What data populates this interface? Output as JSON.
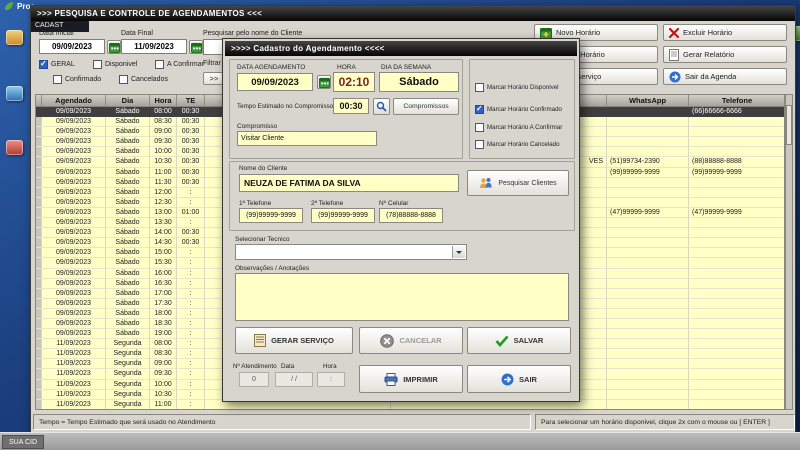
{
  "desktop": {
    "bg_window_title": "Proc",
    "window_fragment": "CADAST",
    "taskbar_button": "SUA CID"
  },
  "window": {
    "title": ">>>   PESQUISA E CONTROLE DE AGENDAMENTOS   <<<",
    "filters": {
      "data_inicial_label": "Data Inicial",
      "data_inicial_value": "09/09/2023",
      "data_final_label": "Data Final",
      "data_final_value": "11/09/2023",
      "search_label": "Pesquisar pelo nome do Cliente",
      "search_value": "",
      "geral": "GERAL",
      "disponivel": "Disponivel",
      "a_confirmar": "A Confirmar",
      "confirmado": "Confirmado",
      "cancelados": "Cancelados",
      "filtrar": "Filtrar",
      "expand": ">>"
    },
    "actions": {
      "novo": "Novo Horário",
      "excluir": "Excluir Horário",
      "alterar": "Alterar Horário",
      "relatorio": "Gerar Relatório",
      "servico": "Gerar Serviço",
      "sair": "Sair da Agenda"
    },
    "table": {
      "headers": [
        "",
        "Agendado",
        "Dia",
        "Hora",
        "TE",
        "",
        "",
        "WhatsApp",
        "Telefone"
      ],
      "rows": [
        {
          "agendado": "09/09/2023",
          "dia": "Sábado",
          "hora": "08:00",
          "te": "00:30",
          "cliente": "",
          "whatsapp": "",
          "telefone": "(66)66666-6666",
          "selected": true
        },
        {
          "agendado": "09/09/2023",
          "dia": "Sábado",
          "hora": "08:30",
          "te": "00:30",
          "cliente": "",
          "whatsapp": "",
          "telefone": "",
          "selected": false
        },
        {
          "agendado": "09/09/2023",
          "dia": "Sábado",
          "hora": "09:00",
          "te": "00:30",
          "cliente": "",
          "whatsapp": "",
          "telefone": "",
          "selected": false
        },
        {
          "agendado": "09/09/2023",
          "dia": "Sábado",
          "hora": "09:30",
          "te": "00:30",
          "cliente": "",
          "whatsapp": "",
          "telefone": "",
          "selected": false
        },
        {
          "agendado": "09/09/2023",
          "dia": "Sábado",
          "hora": "10:00",
          "te": "00:30",
          "cliente": "",
          "whatsapp": "",
          "telefone": "",
          "selected": false
        },
        {
          "agendado": "09/09/2023",
          "dia": "Sábado",
          "hora": "10:30",
          "te": "00:30",
          "cliente": "VES",
          "whatsapp": "(51)99734-2390",
          "telefone": "(88)88888-8888",
          "selected": false
        },
        {
          "agendado": "09/09/2023",
          "dia": "Sábado",
          "hora": "11:00",
          "te": "00:30",
          "cliente": "",
          "whatsapp": "(99)99999-9999",
          "telefone": "(99)99999-9999",
          "selected": false
        },
        {
          "agendado": "09/09/2023",
          "dia": "Sábado",
          "hora": "11:30",
          "te": "00:30",
          "cliente": "",
          "whatsapp": "",
          "telefone": "",
          "selected": false
        },
        {
          "agendado": "09/09/2023",
          "dia": "Sábado",
          "hora": "12:00",
          "te": ":",
          "cliente": "",
          "whatsapp": "",
          "telefone": "",
          "selected": false
        },
        {
          "agendado": "09/09/2023",
          "dia": "Sábado",
          "hora": "12:30",
          "te": ":",
          "cliente": "",
          "whatsapp": "",
          "telefone": "",
          "selected": false
        },
        {
          "agendado": "09/09/2023",
          "dia": "Sábado",
          "hora": "13:00",
          "te": "01:00",
          "cliente": "",
          "whatsapp": "(47)99999-9999",
          "telefone": "(47)99999-9999",
          "selected": false
        },
        {
          "agendado": "09/09/2023",
          "dia": "Sábado",
          "hora": "13:30",
          "te": ":",
          "cliente": "",
          "whatsapp": "",
          "telefone": "",
          "selected": false
        },
        {
          "agendado": "09/09/2023",
          "dia": "Sábado",
          "hora": "14:00",
          "te": "00:30",
          "cliente": "",
          "whatsapp": "",
          "telefone": "",
          "selected": false
        },
        {
          "agendado": "09/09/2023",
          "dia": "Sábado",
          "hora": "14:30",
          "te": "00:30",
          "cliente": "",
          "whatsapp": "",
          "telefone": "",
          "selected": false
        },
        {
          "agendado": "09/09/2023",
          "dia": "Sábado",
          "hora": "15:00",
          "te": ":",
          "cliente": "",
          "whatsapp": "",
          "telefone": "",
          "selected": false
        },
        {
          "agendado": "09/09/2023",
          "dia": "Sábado",
          "hora": "15:30",
          "te": ":",
          "cliente": "",
          "whatsapp": "",
          "telefone": "",
          "selected": false
        },
        {
          "agendado": "09/09/2023",
          "dia": "Sábado",
          "hora": "16:00",
          "te": ":",
          "cliente": "",
          "whatsapp": "",
          "telefone": "",
          "selected": false
        },
        {
          "agendado": "09/09/2023",
          "dia": "Sábado",
          "hora": "16:30",
          "te": ":",
          "cliente": "",
          "whatsapp": "",
          "telefone": "",
          "selected": false
        },
        {
          "agendado": "09/09/2023",
          "dia": "Sábado",
          "hora": "17:00",
          "te": ":",
          "cliente": "",
          "whatsapp": "",
          "telefone": "",
          "selected": false
        },
        {
          "agendado": "09/09/2023",
          "dia": "Sábado",
          "hora": "17:30",
          "te": ":",
          "cliente": "",
          "whatsapp": "",
          "telefone": "",
          "selected": false
        },
        {
          "agendado": "09/09/2023",
          "dia": "Sábado",
          "hora": "18:00",
          "te": ":",
          "cliente": "",
          "whatsapp": "",
          "telefone": "",
          "selected": false
        },
        {
          "agendado": "09/09/2023",
          "dia": "Sábado",
          "hora": "18:30",
          "te": ":",
          "cliente": "",
          "whatsapp": "",
          "telefone": "",
          "selected": false
        },
        {
          "agendado": "09/09/2023",
          "dia": "Sábado",
          "hora": "19:00",
          "te": ":",
          "cliente": "",
          "whatsapp": "",
          "telefone": "",
          "selected": false
        },
        {
          "agendado": "11/09/2023",
          "dia": "Segunda",
          "hora": "08:00",
          "te": ":",
          "cliente": "",
          "whatsapp": "",
          "telefone": "",
          "selected": false
        },
        {
          "agendado": "11/09/2023",
          "dia": "Segunda",
          "hora": "08:30",
          "te": ":",
          "cliente": "",
          "whatsapp": "",
          "telefone": "",
          "selected": false
        },
        {
          "agendado": "11/09/2023",
          "dia": "Segunda",
          "hora": "09:00",
          "te": ":",
          "cliente": "",
          "whatsapp": "",
          "telefone": "",
          "selected": false
        },
        {
          "agendado": "11/09/2023",
          "dia": "Segunda",
          "hora": "09:30",
          "te": ":",
          "cliente": "",
          "whatsapp": "",
          "telefone": "",
          "selected": false
        },
        {
          "agendado": "11/09/2023",
          "dia": "Segunda",
          "hora": "10:00",
          "te": ":",
          "cliente": "",
          "whatsapp": "",
          "telefone": "",
          "selected": false
        },
        {
          "agendado": "11/09/2023",
          "dia": "Segunda",
          "hora": "10:30",
          "te": ":",
          "cliente": "",
          "whatsapp": "",
          "telefone": "",
          "selected": false
        },
        {
          "agendado": "11/09/2023",
          "dia": "Segunda",
          "hora": "11:00",
          "te": ":",
          "cliente": "",
          "whatsapp": "",
          "telefone": "",
          "selected": false
        }
      ]
    },
    "status_left": "Tempo = Tempo Estimado que será usado no Atendimento",
    "status_right": "Para selecionar um horário disponivel, clique 2x com o mouse ou [ ENTER ]"
  },
  "modal": {
    "title": ">>>>   Cadastro do Agendamento   <<<<",
    "data_label": "DATA AGENDAMENTO",
    "data_value": "09/09/2023",
    "hora_label": "HORA",
    "hora_value": "02:10",
    "dia_semana_label": "DIA DA SEMANA",
    "dia_semana_value": "Sábado",
    "tempo_label": "Tempo Estimado no Compromisso",
    "tempo_value": "00:30",
    "compromissos_button": "Compromissos",
    "compromisso_label": "Compromisso",
    "compromisso_value": "Visitar Cliente",
    "chk_disponivel": "Marcar Horário Disponivel",
    "chk_confirmado": "Marcar Horário Confirmado",
    "chk_a_confirmar": "Marcar Horário A Confirmar",
    "chk_cancelado": "Marcar Horário Cancelado",
    "nome_label": "Nome do Cliente",
    "nome_value": "NEUZA DE FATIMA DA SILVA",
    "pesquisar_clientes": "Pesquisar Clientes",
    "tel1_label": "1ª Telefone",
    "tel1_value": "(99)99999-9999",
    "tel2_label": "2ª Telefone",
    "tel2_value": "(99)99999-9999",
    "celular_label": "Nº Celular",
    "celular_value": "(78)88888-8888",
    "tecnico_label": "Selecionar Tecnico",
    "obs_label": "Observações  / Anotações",
    "obs_value": "",
    "gerar_servico": "GERAR  SERVIÇO",
    "cancelar": "CANCELAR",
    "salvar": "SALVAR",
    "atendimento_label": "Nº Atendimento",
    "atendimento_value": "0",
    "data_small_label": "Data",
    "data_small_value": "/  /",
    "hora_small_label": "Hora",
    "hora_small_value": ":",
    "imprimir": "IMPRIMIR",
    "sair": "SAIR"
  }
}
